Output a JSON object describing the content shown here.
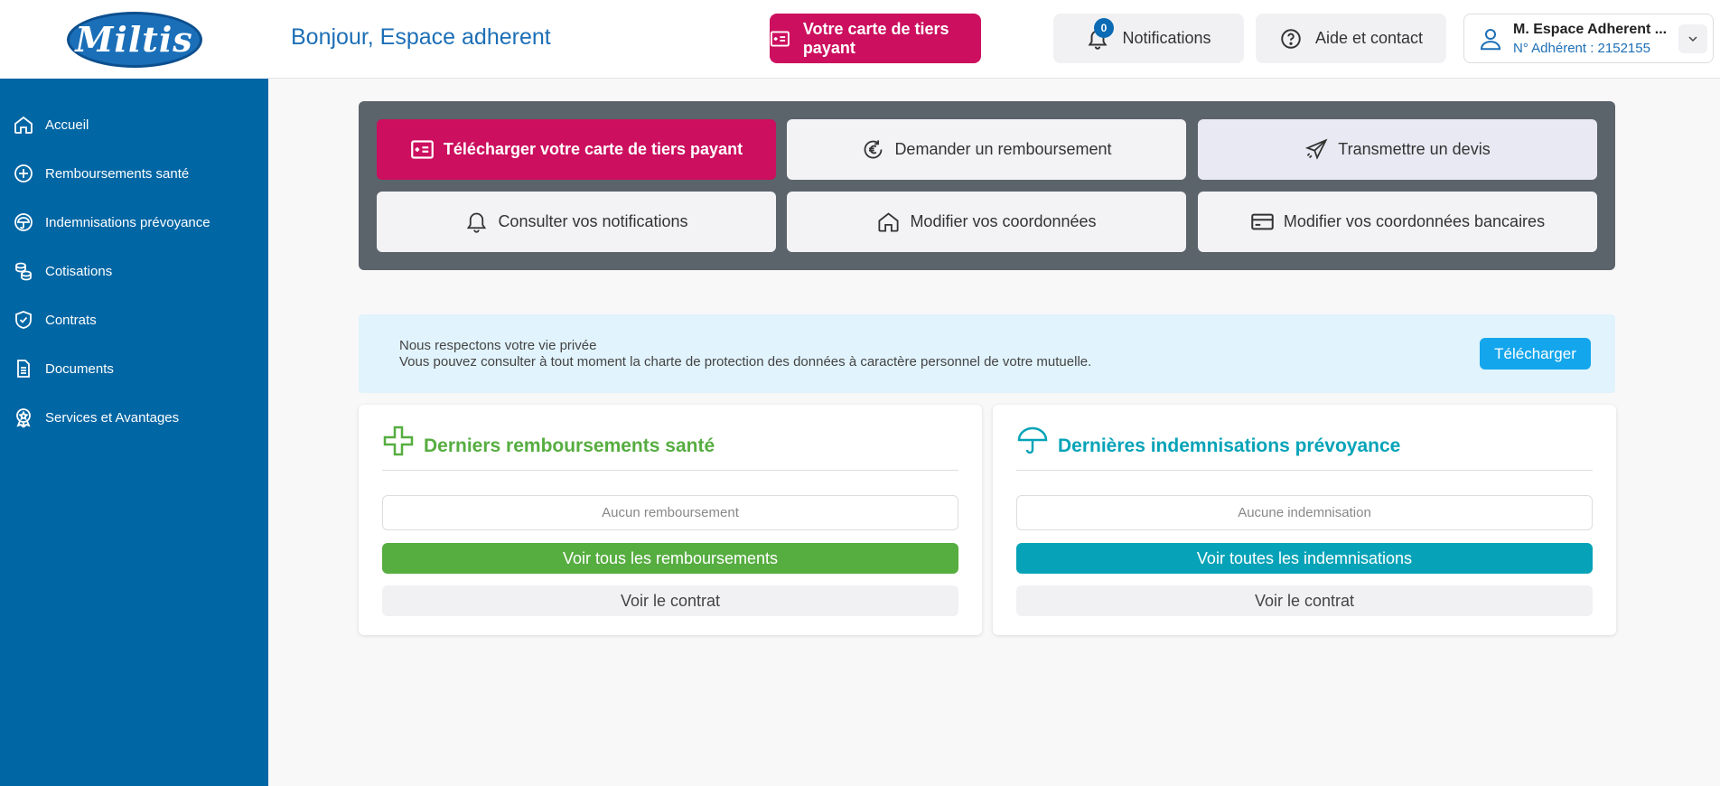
{
  "brand": {
    "logo_text": "Miltis",
    "logo_color": "#1a6fb8"
  },
  "sidebar": {
    "bg_color": "#0066a4",
    "items": [
      {
        "label": "Accueil",
        "icon": "home-icon"
      },
      {
        "label": "Remboursements santé",
        "icon": "health-plus-icon"
      },
      {
        "label": "Indemnisations prévoyance",
        "icon": "umbrella-icon"
      },
      {
        "label": "Cotisations",
        "icon": "coins-icon"
      },
      {
        "label": "Contrats",
        "icon": "shield-check-icon"
      },
      {
        "label": "Documents",
        "icon": "document-icon"
      },
      {
        "label": "Services et Avantages",
        "icon": "award-icon"
      }
    ]
  },
  "header": {
    "greeting": "Bonjour, Espace adherent",
    "card_button": "Votre carte de tiers payant",
    "notifications_label": "Notifications",
    "notifications_count": "0",
    "help_label": "Aide et contact",
    "user_name": "M. Espace Adherent ...",
    "user_number": "N° Adhérent : 2152155",
    "accent_color": "#cc0f5e"
  },
  "quick_actions": [
    {
      "label": "Télécharger votre carte de tiers payant",
      "icon": "id-card-icon"
    },
    {
      "label": "Demander un remboursement",
      "icon": "euro-refresh-icon"
    },
    {
      "label": "Transmettre un devis",
      "icon": "paper-plane-icon"
    },
    {
      "label": "Consulter vos notifications",
      "icon": "bell-icon"
    },
    {
      "label": "Modifier vos coordonnées",
      "icon": "home-icon"
    },
    {
      "label": "Modifier vos coordonnées bancaires",
      "icon": "credit-card-icon"
    }
  ],
  "privacy": {
    "line1": "Nous respectons votre vie privée",
    "line2": "Vous pouvez consulter à tout moment la charte de protection des données à caractère personnel de votre mutuelle.",
    "button": "Télécharger"
  },
  "health_card": {
    "title": "Derniers remboursements santé",
    "empty": "Aucun remboursement",
    "see_all": "Voir tous les remboursements",
    "see_contract": "Voir le contrat",
    "color": "#56ad40"
  },
  "provident_card": {
    "title": "Dernières indemnisations prévoyance",
    "empty": "Aucune indemnisation",
    "see_all": "Voir toutes les indemnisations",
    "see_contract": "Voir le contrat",
    "color": "#06a3b8"
  }
}
